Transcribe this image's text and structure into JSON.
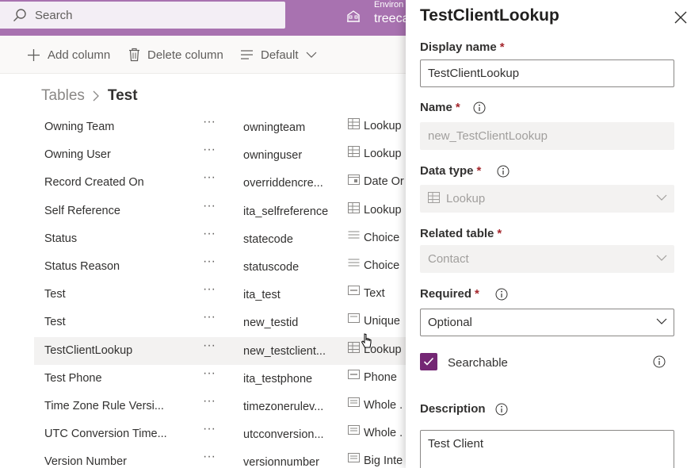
{
  "header": {
    "search_placeholder": "Search",
    "env_label": "Environ",
    "env_name": "treeca",
    "colors": {
      "header_bg": "#a872b0",
      "accent": "#742774"
    }
  },
  "commands": {
    "add_column": "Add column",
    "delete_column": "Delete column",
    "view": "Default"
  },
  "breadcrumb": {
    "root": "Tables",
    "current": "Test"
  },
  "columns": [
    {
      "display": "Owning Team",
      "logical": "owningteam",
      "type": "Lookup",
      "type_icon": "lookup-icon"
    },
    {
      "display": "Owning User",
      "logical": "owninguser",
      "type": "Lookup",
      "type_icon": "lookup-icon"
    },
    {
      "display": "Record Created On",
      "logical": "overriddencre...",
      "type": "Date Or",
      "type_icon": "calendar-icon"
    },
    {
      "display": "Self Reference",
      "logical": "ita_selfreference",
      "type": "Lookup",
      "type_icon": "lookup-icon"
    },
    {
      "display": "Status",
      "logical": "statecode",
      "type": "Choice",
      "type_icon": "choice-icon"
    },
    {
      "display": "Status Reason",
      "logical": "statuscode",
      "type": "Choice",
      "type_icon": "choice-icon"
    },
    {
      "display": "Test",
      "logical": "ita_test",
      "type": "Text",
      "type_icon": "text-icon"
    },
    {
      "display": "Test",
      "logical": "new_testid",
      "type": "Unique",
      "type_icon": "unique-id-icon"
    },
    {
      "display": "TestClientLookup",
      "logical": "new_testclient...",
      "type": "Lookup",
      "type_icon": "lookup-icon"
    },
    {
      "display": "Test Phone",
      "logical": "ita_testphone",
      "type": "Phone",
      "type_icon": "text-icon"
    },
    {
      "display": "Time Zone Rule Versi...",
      "logical": "timezonerulev...",
      "type": "Whole .",
      "type_icon": "number-icon"
    },
    {
      "display": "UTC Conversion Time...",
      "logical": "utcconversion...",
      "type": "Whole .",
      "type_icon": "number-icon"
    },
    {
      "display": "Version Number",
      "logical": "versionnumber",
      "type": "Big Inte",
      "type_icon": "number-icon"
    }
  ],
  "more_glyph": "···",
  "panel": {
    "title": "TestClientLookup",
    "display_name_label": "Display name",
    "display_name_value": "TestClientLookup",
    "name_label": "Name",
    "name_value": "new_TestClientLookup",
    "data_type_label": "Data type",
    "data_type_value": "Lookup",
    "related_table_label": "Related table",
    "related_table_value": "Contact",
    "required_label": "Required",
    "required_value": "Optional",
    "searchable_label": "Searchable",
    "searchable_checked": true,
    "description_label": "Description",
    "description_value": "Test Client",
    "required_marker": "*"
  }
}
